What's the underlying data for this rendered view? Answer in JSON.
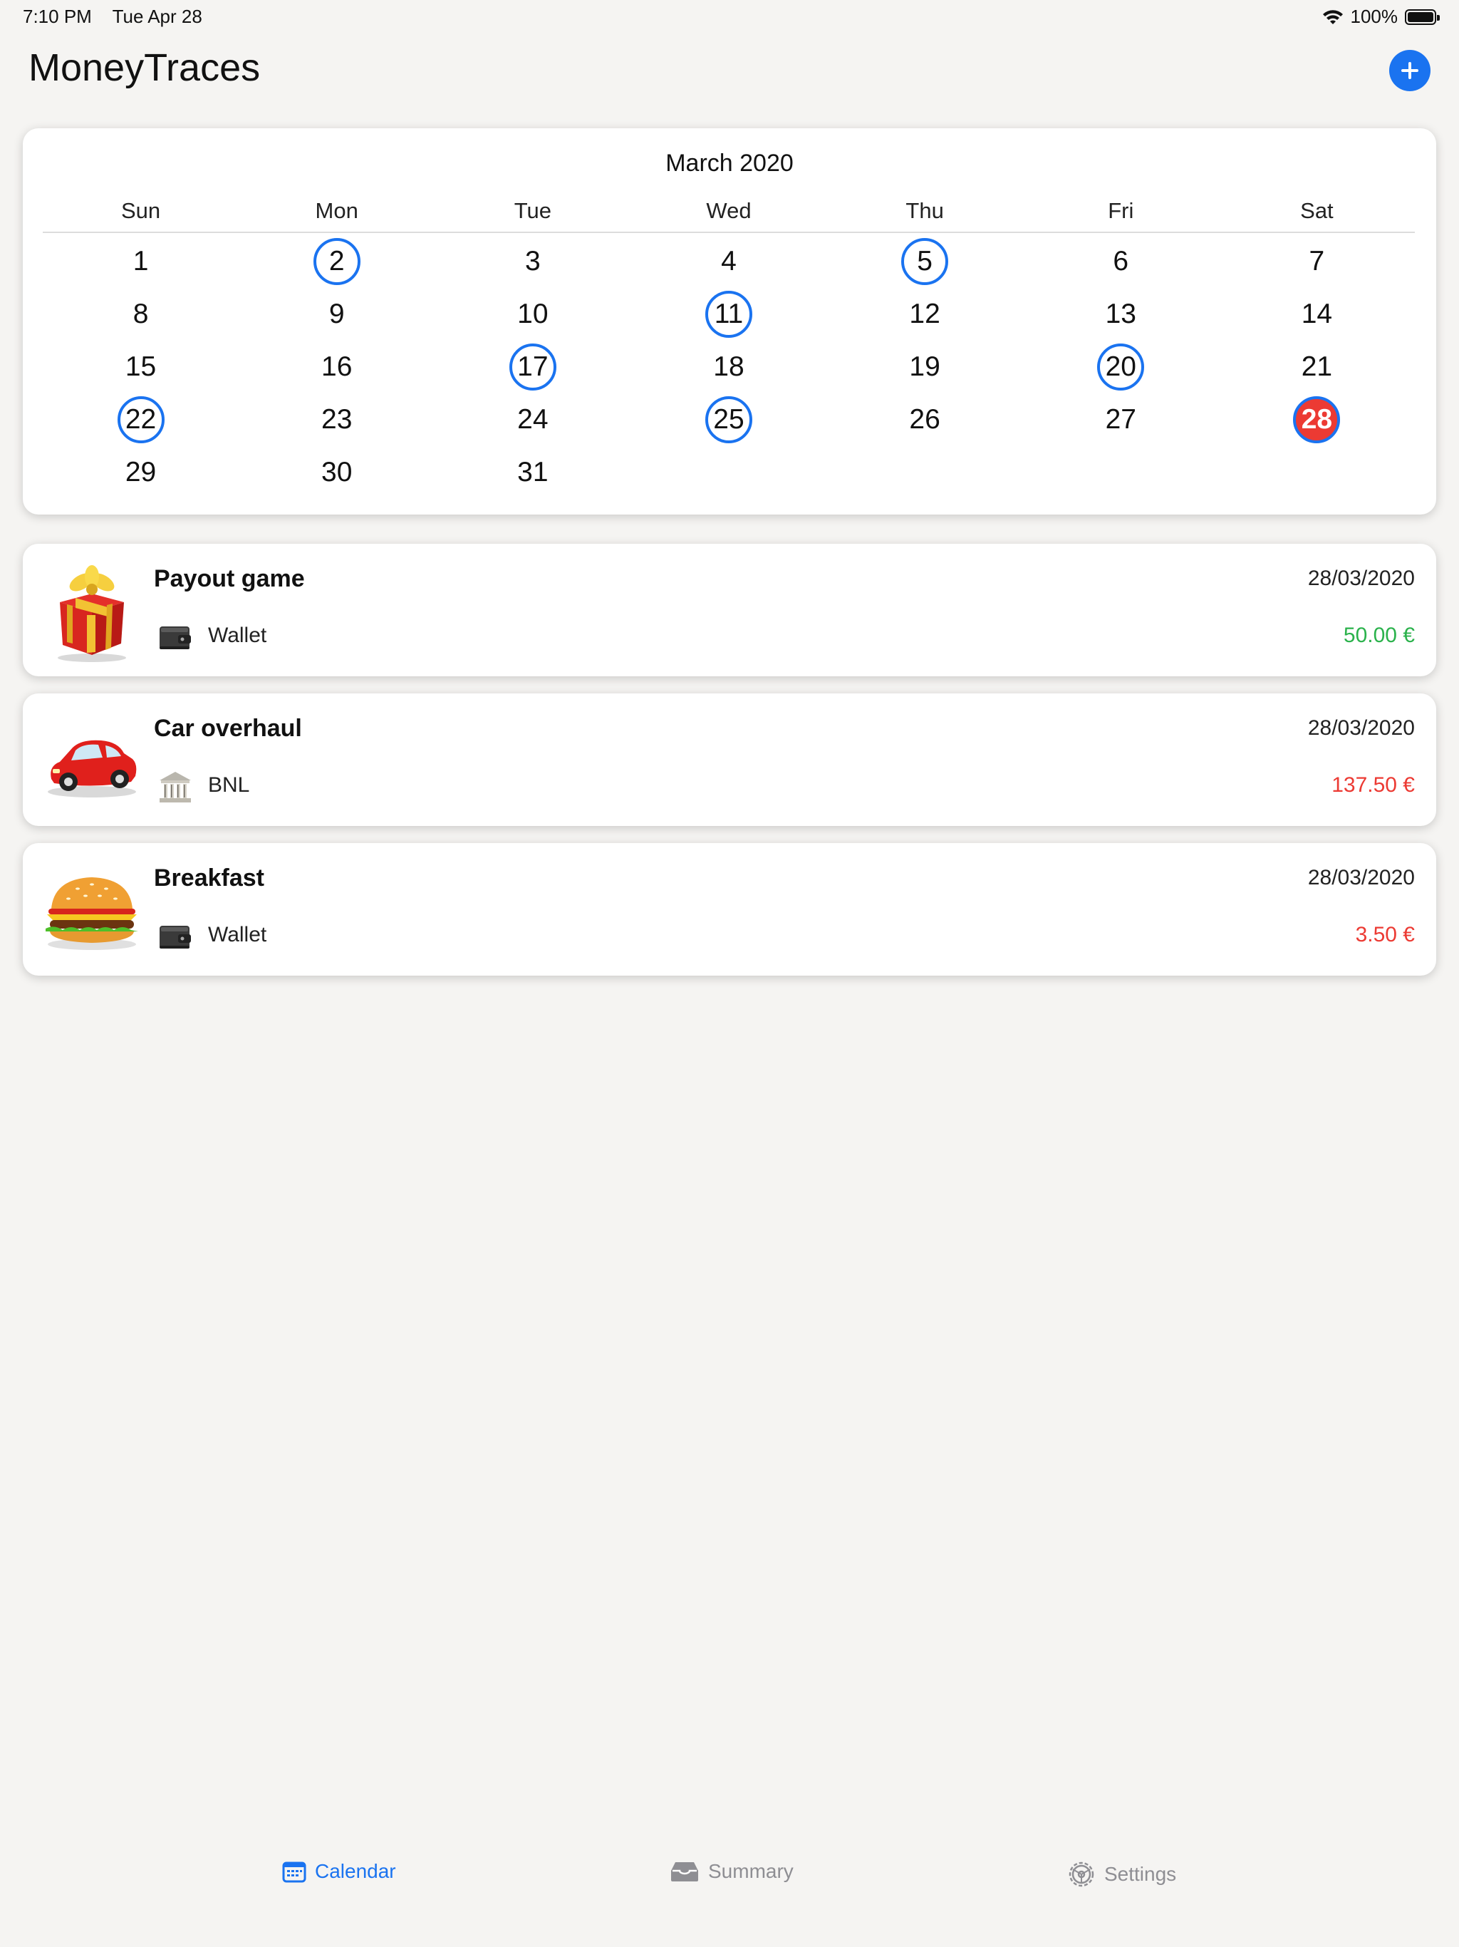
{
  "status_bar": {
    "time": "7:10 PM",
    "date": "Tue Apr 28",
    "battery": "100%",
    "battery_level": 1.0
  },
  "header": {
    "title": "MoneyTraces",
    "add_icon": "plus-circle-icon"
  },
  "calendar": {
    "month": "March 2020",
    "weekdays": [
      "Sun",
      "Mon",
      "Tue",
      "Wed",
      "Thu",
      "Fri",
      "Sat"
    ],
    "first_weekday_index": 0,
    "days": [
      {
        "n": "1"
      },
      {
        "n": "2",
        "marked": true
      },
      {
        "n": "3"
      },
      {
        "n": "4"
      },
      {
        "n": "5",
        "marked": true
      },
      {
        "n": "6"
      },
      {
        "n": "7"
      },
      {
        "n": "8"
      },
      {
        "n": "9"
      },
      {
        "n": "10"
      },
      {
        "n": "11",
        "marked": true
      },
      {
        "n": "12"
      },
      {
        "n": "13"
      },
      {
        "n": "14"
      },
      {
        "n": "15"
      },
      {
        "n": "16"
      },
      {
        "n": "17",
        "marked": true
      },
      {
        "n": "18"
      },
      {
        "n": "19"
      },
      {
        "n": "20",
        "marked": true
      },
      {
        "n": "21"
      },
      {
        "n": "22",
        "marked": true
      },
      {
        "n": "23"
      },
      {
        "n": "24"
      },
      {
        "n": "25",
        "marked": true
      },
      {
        "n": "26"
      },
      {
        "n": "27"
      },
      {
        "n": "28",
        "marked": true,
        "today": true
      },
      {
        "n": "29"
      },
      {
        "n": "30"
      },
      {
        "n": "31"
      }
    ],
    "marked_color": "#1a73f0",
    "today_color": "#ec3a33"
  },
  "transactions": [
    {
      "title": "Payout game",
      "date": "28/03/2020",
      "account": "Wallet",
      "account_icon": "wallet-icon",
      "amount": "50.00 €",
      "type": "income",
      "icon": "gift-icon"
    },
    {
      "title": "Car overhaul",
      "date": "28/03/2020",
      "account": "BNL",
      "account_icon": "bank-icon",
      "amount": "137.50 €",
      "type": "expense",
      "icon": "car-icon"
    },
    {
      "title": "Breakfast",
      "date": "28/03/2020",
      "account": "Wallet",
      "account_icon": "wallet-icon",
      "amount": "3.50 €",
      "type": "expense",
      "icon": "burger-icon"
    }
  ],
  "colors": {
    "income": "#2bb24c",
    "expense": "#ec3a33",
    "accent": "#1a73f0",
    "tab_inactive": "#8e8e93"
  },
  "tabs": [
    {
      "label": "Calendar",
      "icon": "calendar-icon",
      "active": true
    },
    {
      "label": "Summary",
      "icon": "tray-icon",
      "active": false
    },
    {
      "label": "Settings",
      "icon": "gear-icon",
      "active": false
    }
  ]
}
